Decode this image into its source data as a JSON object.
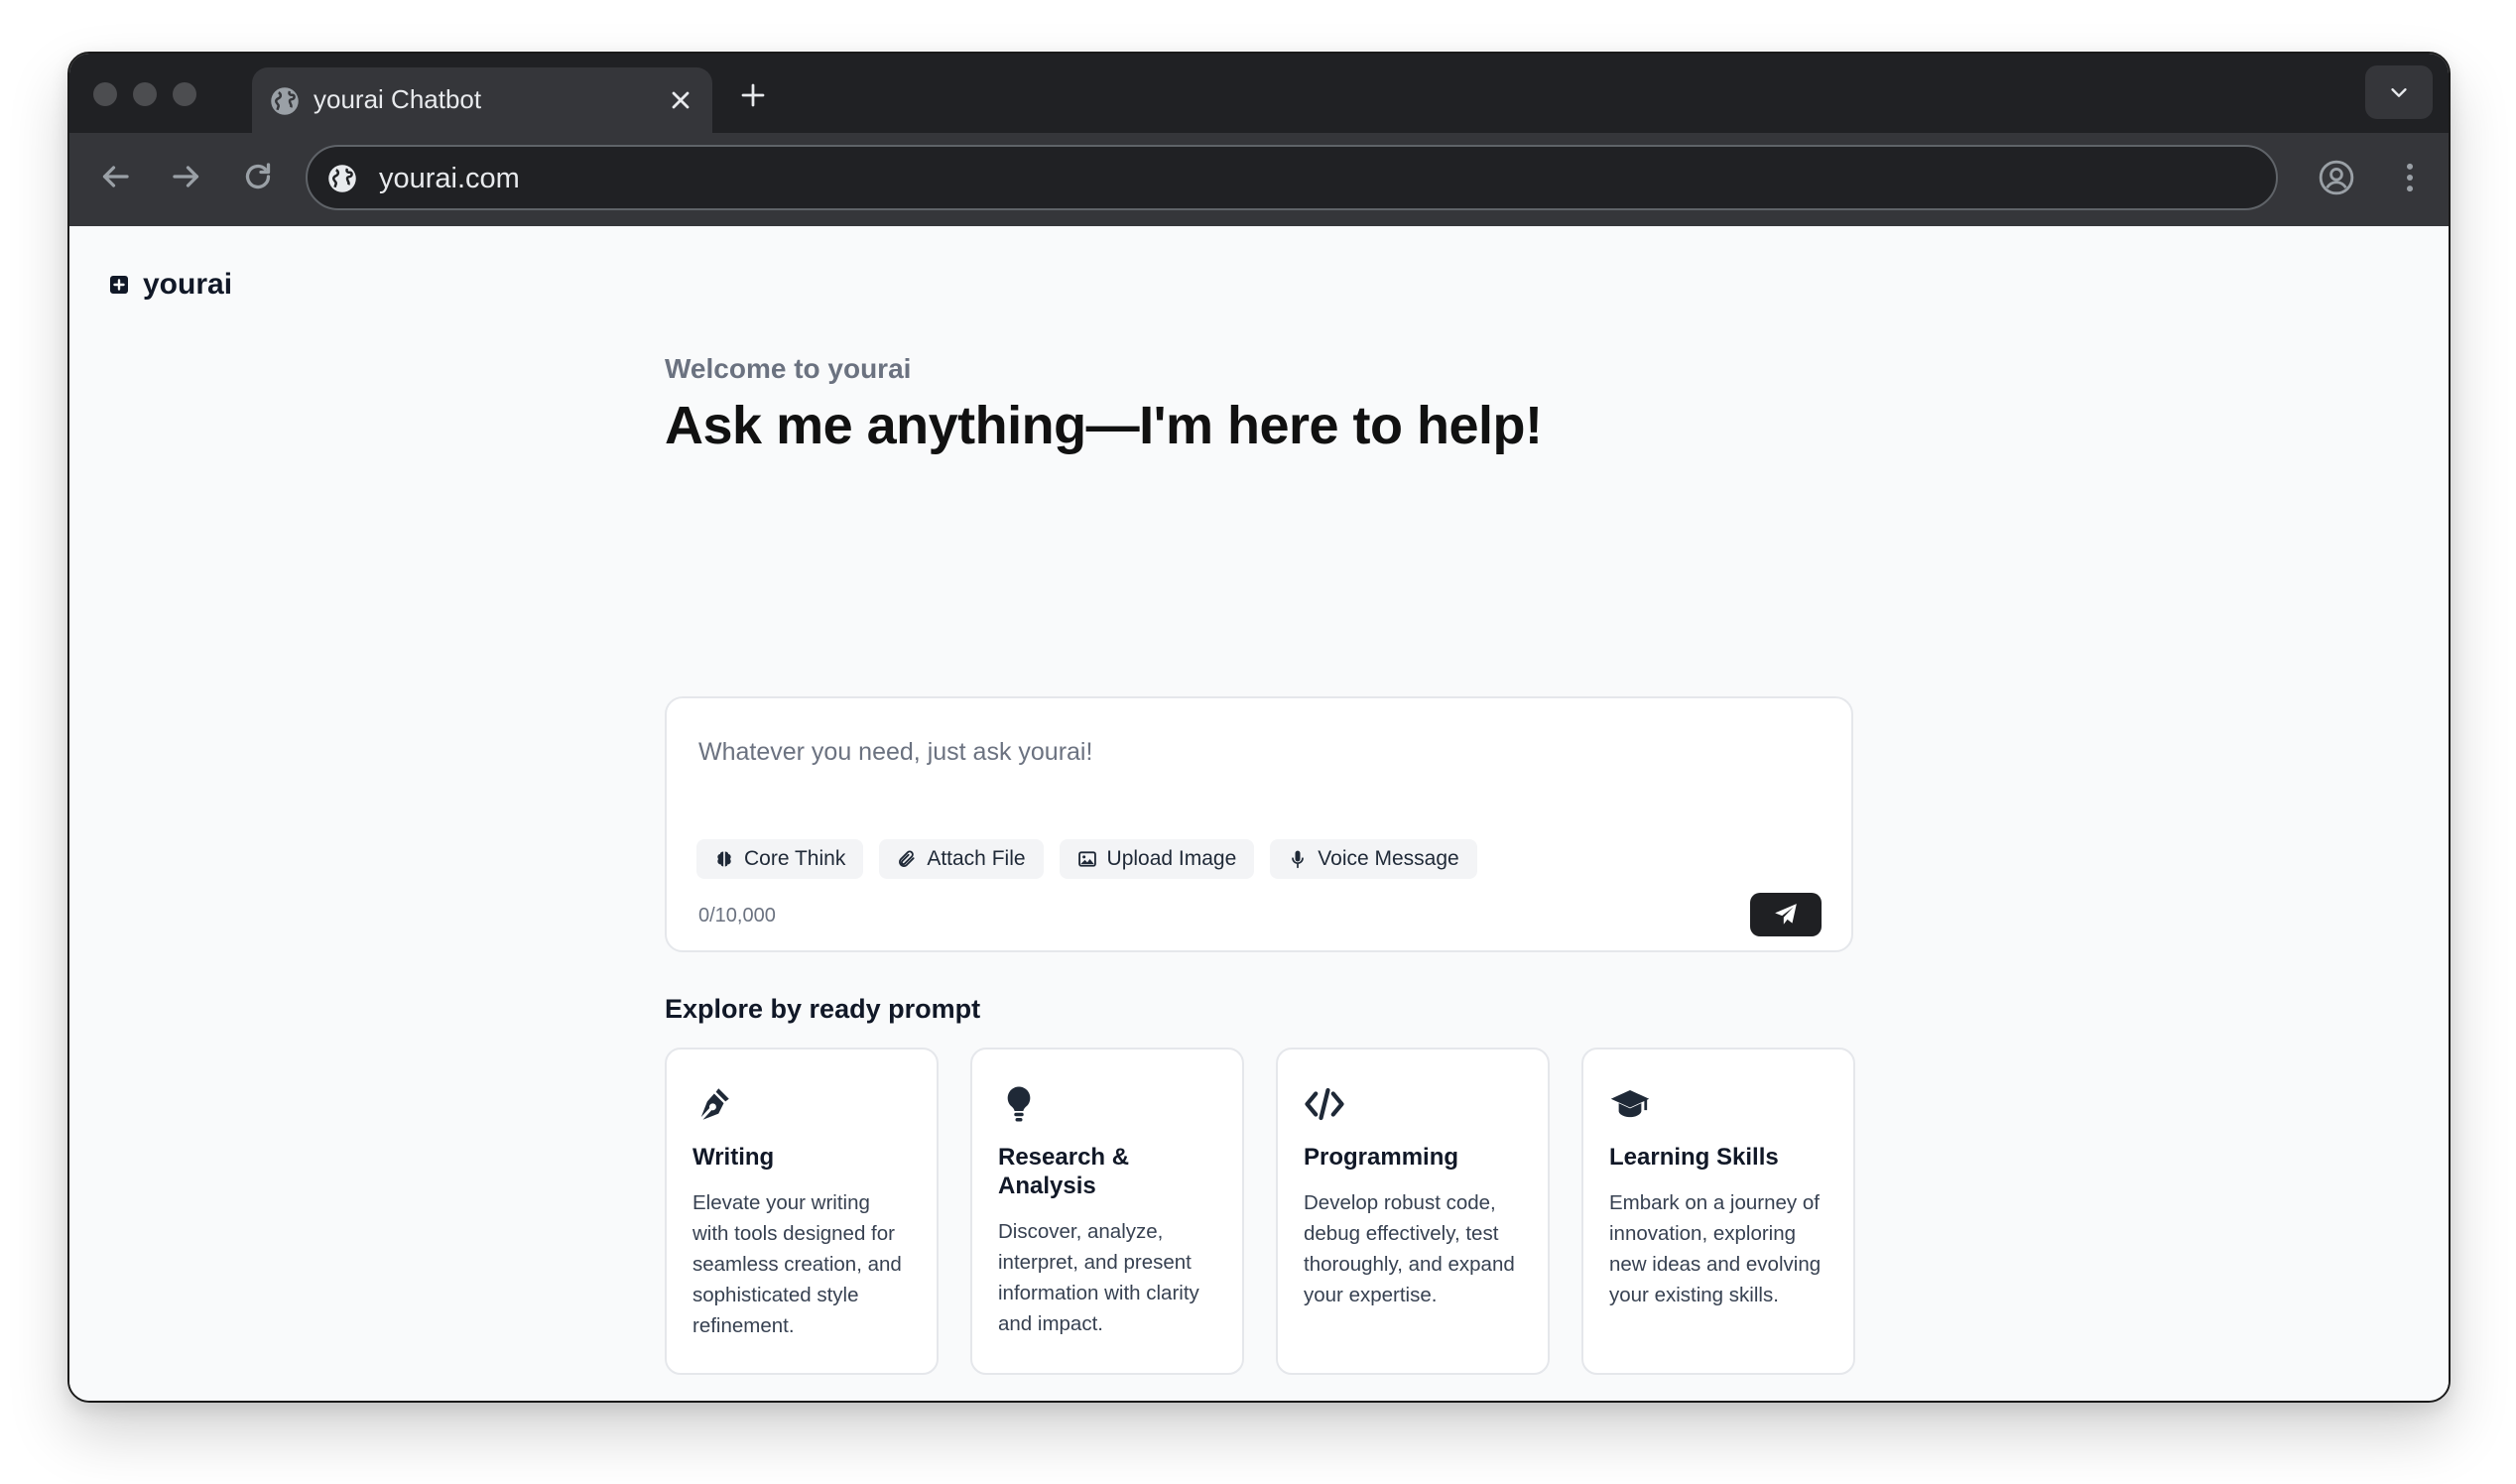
{
  "browser": {
    "tab_title": "yourai Chatbot",
    "url": "yourai.com"
  },
  "app": {
    "brand": "yourai",
    "welcome": "Welcome to yourai",
    "headline": "Ask me anything—I'm here to help!"
  },
  "chat": {
    "placeholder": "Whatever you need, just ask yourai!",
    "counter": "0/10,000",
    "tools": [
      {
        "label": "Core Think",
        "icon": "brain-icon"
      },
      {
        "label": "Attach File",
        "icon": "paperclip-icon"
      },
      {
        "label": "Upload Image",
        "icon": "image-icon"
      },
      {
        "label": "Voice Message",
        "icon": "microphone-icon"
      }
    ],
    "send_icon": "paper-plane-icon"
  },
  "explore": {
    "title": "Explore by ready prompt",
    "cards": [
      {
        "title": "Writing",
        "icon": "pen-nib-icon",
        "description": "Elevate your writing with tools designed for seamless creation, and sophisticated style refinement."
      },
      {
        "title": "Research & Analysis",
        "icon": "lightbulb-icon",
        "description": "Discover, analyze, interpret, and present information with clarity and impact."
      },
      {
        "title": "Programming",
        "icon": "code-icon",
        "description": "Develop robust code, debug effectively, test thoroughly, and expand your expertise."
      },
      {
        "title": "Learning Skills",
        "icon": "graduation-cap-icon",
        "description": "Embark on a journey of innovation, exploring new ideas and evolving your existing skills."
      }
    ]
  },
  "colors": {
    "tabbar": "#202124",
    "toolbar": "#35363a",
    "page_bg": "#f9fafb",
    "send_button": "#1f2023",
    "text_primary": "#111827",
    "text_muted": "#6b7280"
  }
}
